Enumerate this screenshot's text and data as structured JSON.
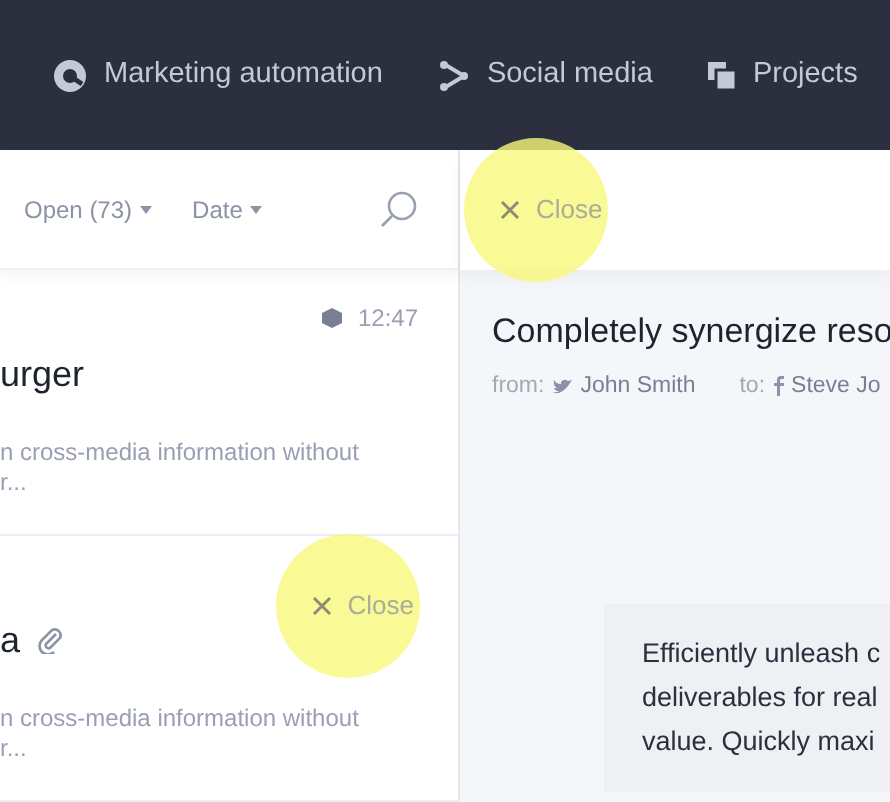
{
  "nav": [
    {
      "kind": "automation",
      "label": "Marketing automation"
    },
    {
      "kind": "social",
      "label": "Social media"
    },
    {
      "kind": "projects",
      "label": "Projects"
    }
  ],
  "list_toolbar": {
    "filters": [
      "Open (73)",
      "Date"
    ]
  },
  "messages": [
    {
      "time": "12:47",
      "title": "urger",
      "attachment": false,
      "preview": [
        "n cross-media information without",
        "r..."
      ]
    },
    {
      "close": "Close",
      "title": "a",
      "attachment": true,
      "preview": [
        "n cross-media information without",
        "r..."
      ]
    }
  ],
  "detail": {
    "close": "Close",
    "subject": "Completely synergize reso",
    "from_label": "from:",
    "from": "John Smith",
    "to_label": "to:",
    "to": "Steve Jo",
    "body": [
      "Efficiently unleash c",
      "deliverables for real",
      "value. Quickly maxi"
    ]
  }
}
